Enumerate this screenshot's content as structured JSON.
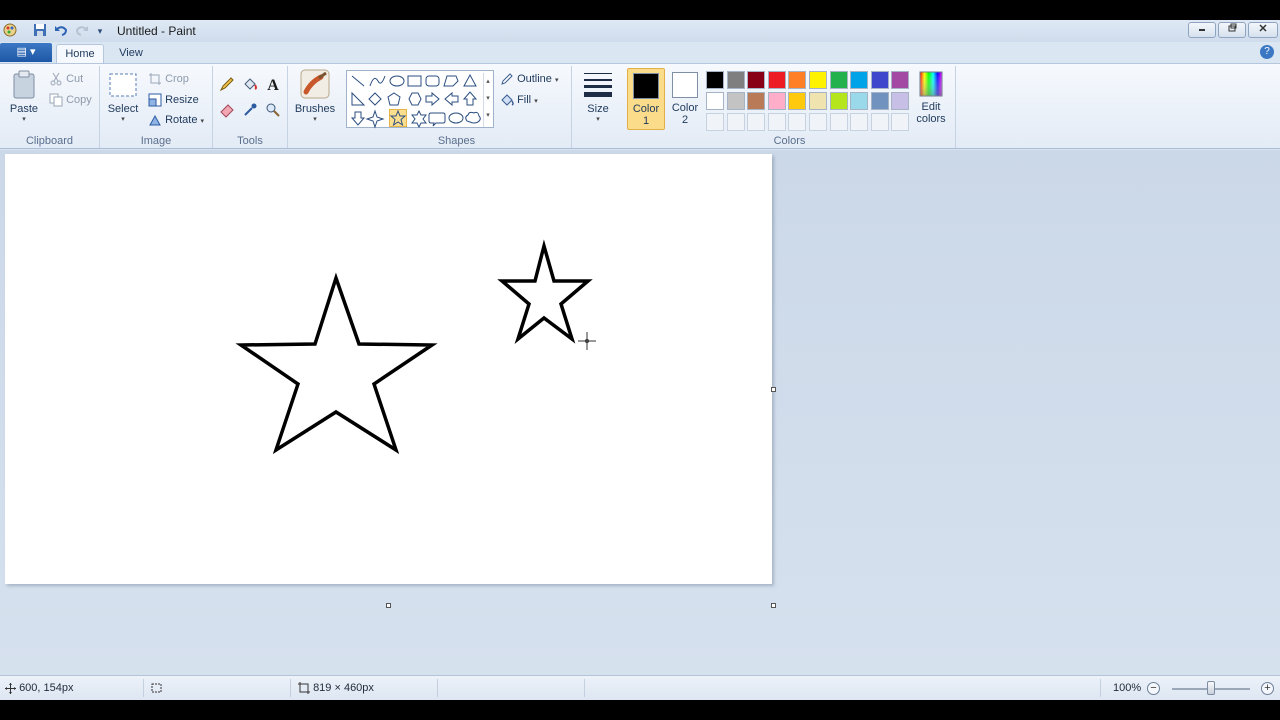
{
  "window": {
    "title": "Untitled - Paint"
  },
  "tabs": {
    "file_label": "▤ ▾",
    "home": "Home",
    "view": "View",
    "help": "?"
  },
  "clipboard": {
    "paste": "Paste",
    "cut": "Cut",
    "copy": "Copy",
    "group": "Clipboard"
  },
  "image": {
    "select": "Select",
    "crop": "Crop",
    "resize": "Resize",
    "rotate": "Rotate",
    "group": "Image"
  },
  "tools": {
    "group": "Tools",
    "text_tool": "A"
  },
  "brushes": {
    "label": "Brushes"
  },
  "shapes": {
    "outline": "Outline",
    "fill": "Fill",
    "group": "Shapes",
    "selected": "five-point-star"
  },
  "size": {
    "label": "Size"
  },
  "colors": {
    "color1_label": "Color",
    "color1_num": "1",
    "color2_label": "Color",
    "color2_num": "2",
    "color1": "#000000",
    "color2": "#ffffff",
    "edit_label_1": "Edit",
    "edit_label_2": "colors",
    "group": "Colors",
    "palette_row1": [
      "#000000",
      "#7f7f7f",
      "#880015",
      "#ed1c24",
      "#ff7f27",
      "#fff200",
      "#22b14c",
      "#00a2e8",
      "#3f48cc",
      "#a349a4"
    ],
    "palette_row2": [
      "#ffffff",
      "#c3c3c3",
      "#b97a57",
      "#ffaec9",
      "#ffc90e",
      "#efe4b0",
      "#b5e61d",
      "#99d9ea",
      "#7092be",
      "#c8bfe7"
    ],
    "palette_row3": [
      "#f0f4f9",
      "#f0f4f9",
      "#f0f4f9",
      "#f0f4f9",
      "#f0f4f9",
      "#f0f4f9",
      "#f0f4f9",
      "#f0f4f9",
      "#f0f4f9",
      "#f0f4f9"
    ]
  },
  "status": {
    "cursor_pos": "600, 154px",
    "image_size": "819 × 460px",
    "zoom": "100%"
  }
}
